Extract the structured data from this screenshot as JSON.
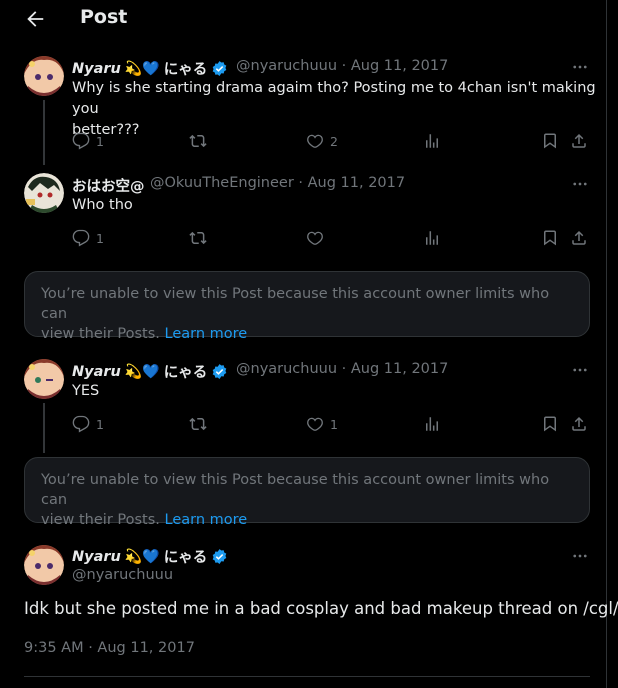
{
  "header": {
    "title": "Post"
  },
  "posts": [
    {
      "display_name": "Nyaru",
      "emojis": "💫💙",
      "jp_name": "にゃる",
      "handle_meta": "@nyaruchuuu · Aug 11, 2017",
      "text_line1": "Why is she starting drama agaim tho? Posting me to 4chan isn't making you",
      "text_line2": "better???",
      "replies": "1",
      "likes": "2"
    },
    {
      "display_name": "おはお空@",
      "handle_meta": "@OkuuTheEngineer · Aug 11, 2017",
      "text_line1": "Who tho",
      "replies": "1"
    },
    {
      "display_name": "Nyaru",
      "emojis": "💫💙",
      "jp_name": "にゃる",
      "handle_meta": "@nyaruchuuu · Aug 11, 2017",
      "text_line1": "YES",
      "replies": "1",
      "likes": "1"
    }
  ],
  "limited": {
    "line1": "You’re unable to view this Post because this account owner limits who can",
    "line2_prefix": "view their Posts.",
    "learn_more": "Learn more"
  },
  "main_post": {
    "display_name": "Nyaru",
    "emojis": "💫💙",
    "jp_name": "にゃる",
    "handle": "@nyaruchuuu",
    "text": "Idk but she posted me in a bad cosplay and bad makeup thread on /cgl/",
    "timestamp": "9:35 AM · Aug 11, 2017"
  },
  "icons": [
    "back-arrow-icon",
    "verified-badge-icon",
    "more-icon",
    "reply-icon",
    "repost-icon",
    "like-icon",
    "views-icon",
    "bookmark-icon",
    "share-icon"
  ],
  "colors": {
    "background": "#000000",
    "text": "#e7e9ea",
    "muted": "#71767b",
    "accent": "#1d9bf0",
    "card": "#16181c"
  }
}
